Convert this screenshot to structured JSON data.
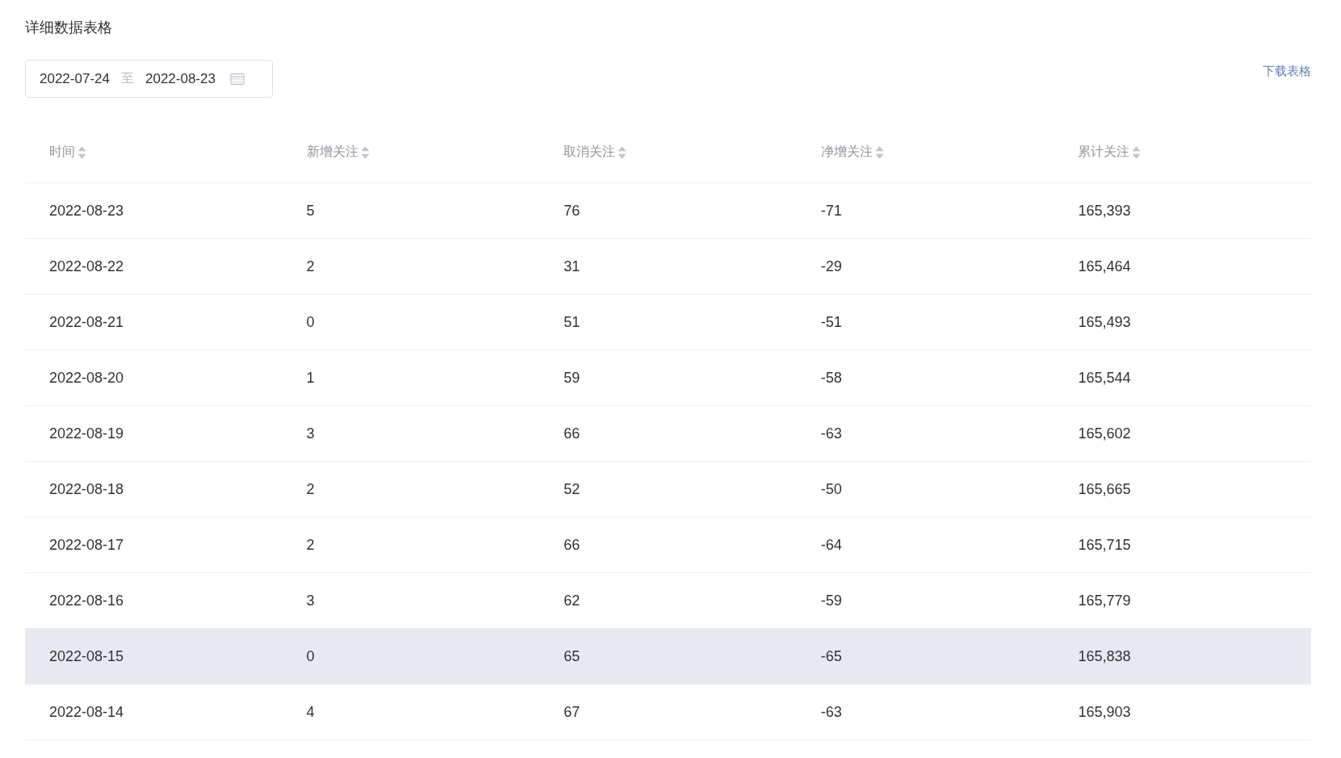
{
  "title": "详细数据表格",
  "date_range": {
    "start": "2022-07-24",
    "separator": "至",
    "end": "2022-08-23"
  },
  "download_link": "下载表格",
  "table": {
    "columns": [
      {
        "label": "时间"
      },
      {
        "label": "新增关注"
      },
      {
        "label": "取消关注"
      },
      {
        "label": "净增关注"
      },
      {
        "label": "累计关注"
      }
    ],
    "rows": [
      {
        "cells": [
          "2022-08-23",
          "5",
          "76",
          "-71",
          "165,393"
        ],
        "highlighted": false
      },
      {
        "cells": [
          "2022-08-22",
          "2",
          "31",
          "-29",
          "165,464"
        ],
        "highlighted": false
      },
      {
        "cells": [
          "2022-08-21",
          "0",
          "51",
          "-51",
          "165,493"
        ],
        "highlighted": false
      },
      {
        "cells": [
          "2022-08-20",
          "1",
          "59",
          "-58",
          "165,544"
        ],
        "highlighted": false
      },
      {
        "cells": [
          "2022-08-19",
          "3",
          "66",
          "-63",
          "165,602"
        ],
        "highlighted": false
      },
      {
        "cells": [
          "2022-08-18",
          "2",
          "52",
          "-50",
          "165,665"
        ],
        "highlighted": false
      },
      {
        "cells": [
          "2022-08-17",
          "2",
          "66",
          "-64",
          "165,715"
        ],
        "highlighted": false
      },
      {
        "cells": [
          "2022-08-16",
          "3",
          "62",
          "-59",
          "165,779"
        ],
        "highlighted": false
      },
      {
        "cells": [
          "2022-08-15",
          "0",
          "65",
          "-65",
          "165,838"
        ],
        "highlighted": true
      },
      {
        "cells": [
          "2022-08-14",
          "4",
          "67",
          "-63",
          "165,903"
        ],
        "highlighted": false
      }
    ]
  }
}
